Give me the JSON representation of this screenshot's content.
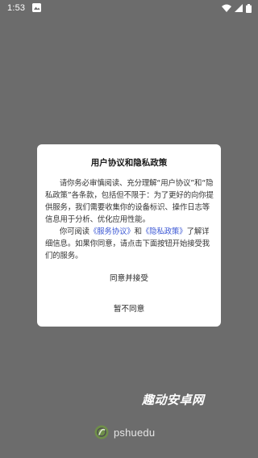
{
  "status_bar": {
    "time": "1:53"
  },
  "dialog": {
    "title": "用户协议和隐私政策",
    "paragraph1": "请你务必审慎阅读、充分理解“用户协议”和“隐私政策”各条款，包括但不限于：为了更好的向你提供服务，我们需要收集你的设备标识、操作日志等信息用于分析、优化应用性能。",
    "p2_prefix": "你可阅读",
    "service_link": "《服务协议》",
    "p2_and": "和",
    "privacy_link": "《隐私政策》",
    "p2_suffix": "了解详细信息。如果你同意，请点击下面按钮开始接受我们的服务。",
    "agree_label": "同意并接受",
    "decline_label": "暂不同意"
  },
  "watermark": "趣动安卓网",
  "brand": {
    "name": "pshuedu"
  },
  "colors": {
    "background": "#6c6c6c",
    "link": "#3a56d4",
    "logo": "#6f8f4a"
  }
}
